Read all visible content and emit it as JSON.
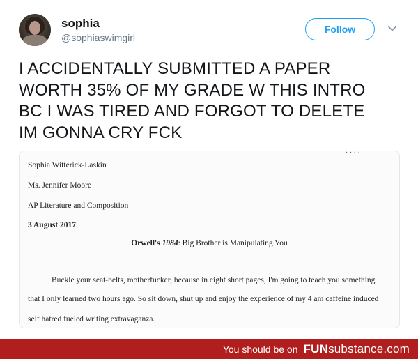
{
  "tweet": {
    "author_name": "sophia",
    "author_handle": "@sophiaswimgirl",
    "follow_label": "Follow",
    "text_lines": [
      "I ACCIDENTALLY SUBMITTED A PAPER",
      "WORTH 35% OF MY GRADE W THIS INTRO",
      "BC I WAS TIRED AND FORGOT TO DELETE",
      "IM GONNA CRY FCK"
    ]
  },
  "document": {
    "student": "Sophia Witterick-Laskin",
    "teacher": "Ms. Jennifer Moore",
    "course": "AP Literature and Composition",
    "date": "3 August 2017",
    "title_prefix": "Orwell's ",
    "title_italic": "1984",
    "title_suffix": ": Big Brother is Manipulating You",
    "paragraph": [
      "Buckle your seat-belts, motherfucker, because in eight short pages, I'm going to teach you something",
      "that I only learned two hours ago. So sit down, shut up and enjoy the experience of my 4 am caffeine induced",
      "self hatred fueled writing extravaganza."
    ]
  },
  "footer": {
    "tagline": "You should be on",
    "brand_bold": "FUN",
    "brand_rest": "substance.com"
  },
  "colors": {
    "accent": "#1da1f2",
    "footer_bg": "#b01e1e",
    "handle": "#657786"
  },
  "icons": {
    "chevron": "chevron-down-icon"
  }
}
